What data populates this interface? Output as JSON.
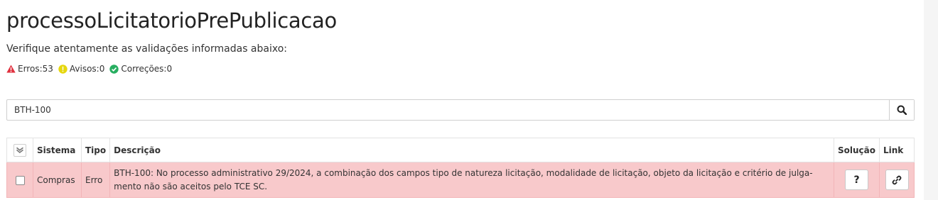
{
  "page": {
    "title": "processoLicitatorioPrePublicacao",
    "subtitle": "Verifique atentamente as validações informadas abaixo:"
  },
  "counters": {
    "errors": "Erros:53",
    "warnings": "Avisos:0",
    "corrections": "Correções:0"
  },
  "search": {
    "value": "BTH-100",
    "icon": "search-icon"
  },
  "table": {
    "headers": {
      "select_all_icon": "double-check-icon",
      "sistema": "Sistema",
      "tipo": "Tipo",
      "descricao": "Descrição",
      "solucao": "Solução",
      "link": "Link"
    },
    "rows": [
      {
        "sistema": "Compras",
        "tipo": "Erro",
        "descricao": "BTH-100: No processo administrativo 29/2024, a combinação dos campos tipo de natureza licitação, modalidade de licitação, objeto da licitação e critério de julga-mento não são aceitos pelo TCE SC.",
        "solucao_label": "?",
        "link_icon": "link-icon"
      }
    ]
  },
  "colors": {
    "error": "#e0303e",
    "warning": "#e6d70f",
    "success": "#27ae60",
    "error_row": "#f8c9cb"
  }
}
